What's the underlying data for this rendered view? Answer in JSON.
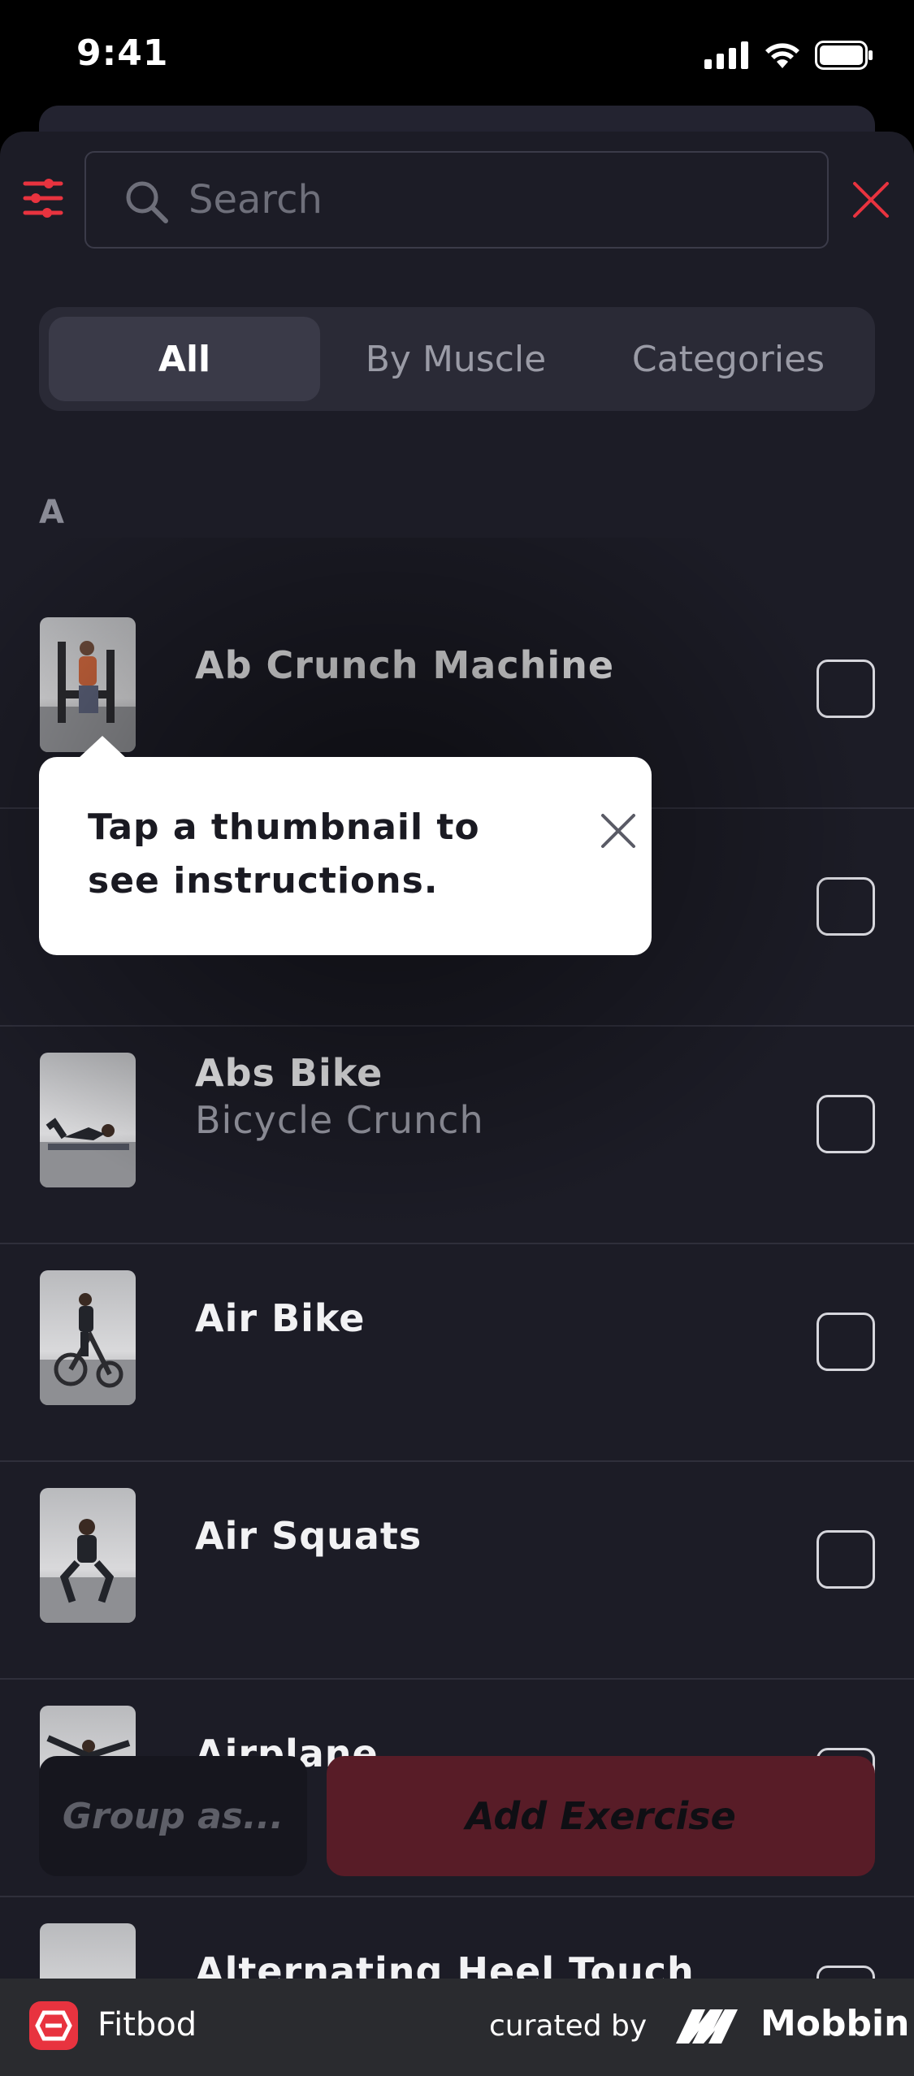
{
  "status_bar": {
    "time": "9:41"
  },
  "search": {
    "placeholder": "Search"
  },
  "tabs": [
    {
      "label": "All",
      "active": true
    },
    {
      "label": "By Muscle",
      "active": false
    },
    {
      "label": "Categories",
      "active": false
    }
  ],
  "section_letter": "A",
  "exercises": [
    {
      "name": "Ab Crunch Machine",
      "subtitle": ""
    },
    {
      "name": "",
      "subtitle": ""
    },
    {
      "name": "Abs Bike",
      "subtitle": "Bicycle Crunch"
    },
    {
      "name": "Air Bike",
      "subtitle": ""
    },
    {
      "name": "Air Squats",
      "subtitle": ""
    },
    {
      "name": "Airplane",
      "subtitle": ""
    },
    {
      "name": "Alternating Heel Touch",
      "subtitle": ""
    }
  ],
  "tooltip": {
    "text": "Tap a thumbnail to see instructions."
  },
  "actions": {
    "group_label": "Group as...",
    "add_label": "Add Exercise"
  },
  "footer": {
    "app_name": "Fitbod",
    "curated_by": "curated by",
    "brand": "Mobbin"
  },
  "colors": {
    "accent": "#e8333f",
    "background": "#1c1c26",
    "add_button": "#581c27"
  }
}
